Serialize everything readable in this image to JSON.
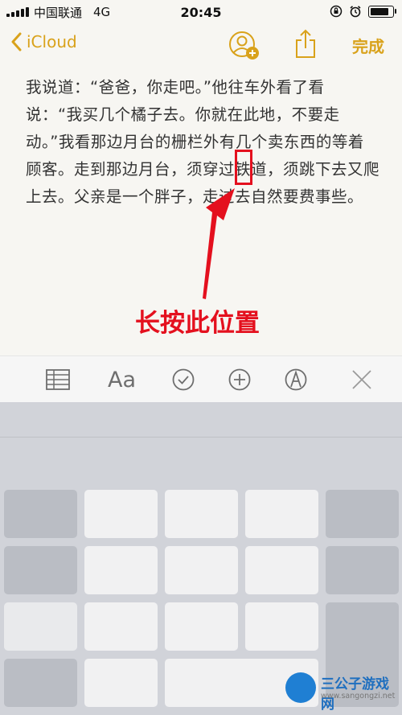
{
  "status": {
    "carrier": "中国联通",
    "network": "4G",
    "time": "20:45"
  },
  "nav": {
    "back_label": "iCloud",
    "done_label": "完成"
  },
  "note": {
    "text": "我说道：“爸爸，你走吧。”他往车外看了看说：“我买几个橘子去。你就在此地，不要走动。”我看那边月台的栅栏外有几个卖东西的等着顾客。走到那边月台，须穿过铁道，须跳下去又爬上去。父亲是一个胖子，走过去自然要费事些。"
  },
  "annotation": {
    "text": "长按此位置"
  },
  "toolbar": {
    "format_label": "Aa"
  },
  "watermark": {
    "name": "三公子游戏网",
    "url": "www.sangongzi.net"
  },
  "colors": {
    "accent": "#d9a21b",
    "annotation_red": "#e4101e"
  }
}
